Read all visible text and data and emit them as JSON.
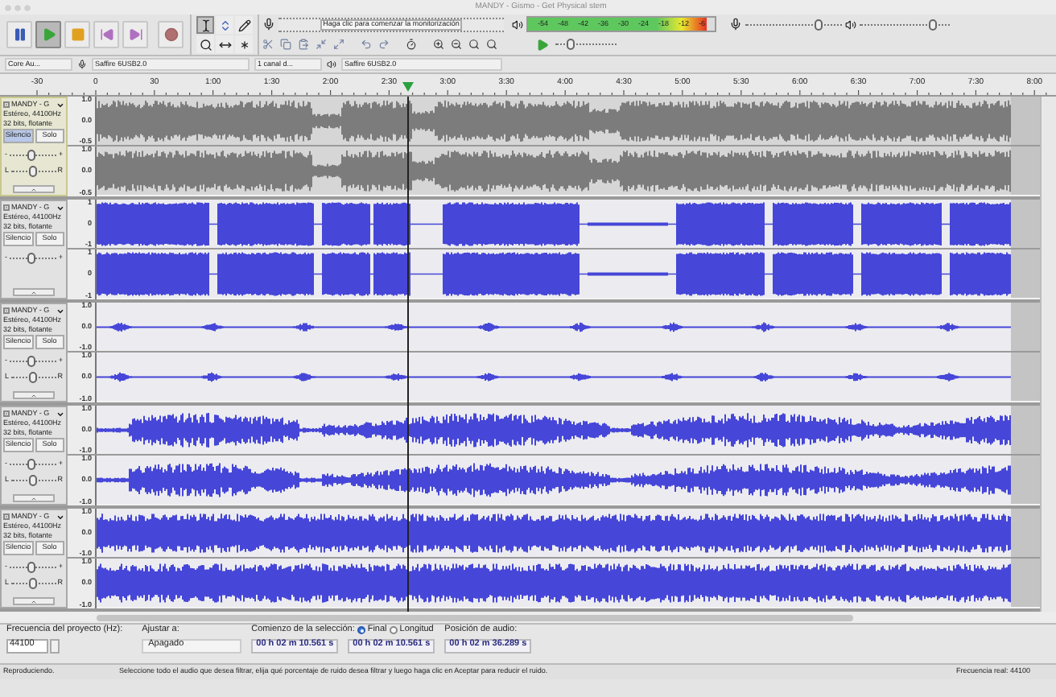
{
  "window": {
    "title": "MANDY - Gismo - Get Physical stem"
  },
  "transport": [
    {
      "kind": "pause",
      "pressed": false
    },
    {
      "kind": "play",
      "pressed": true
    },
    {
      "kind": "stop",
      "pressed": false
    },
    {
      "kind": "skip-start",
      "pressed": false
    },
    {
      "kind": "skip-end",
      "pressed": false
    },
    {
      "kind": "record",
      "pressed": false
    }
  ],
  "tools": [
    {
      "kind": "select",
      "selected": true
    },
    {
      "kind": "envelope",
      "selected": false
    },
    {
      "kind": "draw",
      "selected": false
    },
    {
      "kind": "zoom",
      "selected": false
    },
    {
      "kind": "time-shift",
      "selected": false
    },
    {
      "kind": "multi",
      "selected": false
    }
  ],
  "recording_meter": {
    "hint": "Haga clic para comenzar la monitorización"
  },
  "playback_meter": {
    "ticks": [
      "-54",
      "-48",
      "-42",
      "-36",
      "-30",
      "-24",
      "-18",
      "-12",
      "-6"
    ],
    "level": 0.96
  },
  "mixer": {
    "input_volume": {
      "level": 0.76
    },
    "output_volume": {
      "level": 0.83
    }
  },
  "play_at_speed": {
    "level": 0.25
  },
  "devices": {
    "host": "Core Au...",
    "input": "Saffire 6USB2.0",
    "channels": "1 canal d...",
    "output": "Saffire 6USB2.0"
  },
  "ruler": {
    "labels": [
      "-30",
      "0",
      "30",
      "1:00",
      "1:30",
      "2:00",
      "2:30",
      "3:00",
      "3:30",
      "4:00",
      "4:30",
      "5:00",
      "5:30",
      "6:00",
      "6:30",
      "7:00",
      "7:30",
      "8:00"
    ]
  },
  "tracks": [
    {
      "name": "MANDY - G",
      "format": "Estéreo, 44100Hz",
      "bits": "32 bits, flotante",
      "mute": "Silencio",
      "solo": "Solo",
      "muted": true,
      "selected": true,
      "gain": {
        "labels": [
          "-",
          "+"
        ],
        "level": 0.5
      },
      "pan": {
        "labels": [
          "L",
          "R"
        ],
        "level": 0.5
      },
      "channels": [
        {
          "axis": [
            "1.0",
            "0.0",
            "-0.5"
          ]
        },
        {
          "axis": [
            "1.0",
            "0.0",
            "-0.5"
          ]
        }
      ]
    },
    {
      "name": "MANDY - G",
      "format": "Estéreo, 44100Hz",
      "bits": "32 bits, flotante",
      "mute": "Silencio",
      "solo": "Solo",
      "muted": false,
      "selected": false,
      "gain": {
        "labels": [
          "-",
          "+"
        ],
        "level": 0.5
      },
      "channels": [
        {
          "axis": [
            "1",
            "0",
            "-1"
          ]
        },
        {
          "axis": [
            "1",
            "0",
            "-1"
          ]
        }
      ]
    },
    {
      "name": "MANDY - G",
      "format": "Estéreo, 44100Hz",
      "bits": "32 bits, flotante",
      "mute": "Silencio",
      "solo": "Solo",
      "muted": false,
      "selected": false,
      "gain": {
        "labels": [
          "-",
          "+"
        ],
        "level": 0.5
      },
      "pan": {
        "labels": [
          "L",
          "R"
        ],
        "level": 0.5
      },
      "channels": [
        {
          "axis": [
            "1.0",
            "0.0",
            "-1.0"
          ]
        },
        {
          "axis": [
            "1.0",
            "0.0",
            "-1.0"
          ]
        }
      ]
    },
    {
      "name": "MANDY - G",
      "format": "Estéreo, 44100Hz",
      "bits": "32 bits, flotante",
      "mute": "Silencio",
      "solo": "Solo",
      "muted": false,
      "selected": false,
      "gain": {
        "labels": [
          "-",
          "+"
        ],
        "level": 0.5
      },
      "pan": {
        "labels": [
          "L",
          "R"
        ],
        "level": 0.5
      },
      "channels": [
        {
          "axis": [
            "1.0",
            "0.0",
            "-1.0"
          ]
        },
        {
          "axis": [
            "1.0",
            "0.0",
            "-1.0"
          ]
        }
      ]
    },
    {
      "name": "MANDY - G",
      "format": "Estéreo, 44100Hz",
      "bits": "32 bits, flotante",
      "mute": "Silencio",
      "solo": "Solo",
      "muted": false,
      "selected": false,
      "gain": {
        "labels": [
          "-",
          "+"
        ],
        "level": 0.5
      },
      "pan": {
        "labels": [
          "L",
          "R"
        ],
        "level": 0.5
      },
      "channels": [
        {
          "axis": [
            "1.0",
            "0.0",
            "-1.0"
          ]
        },
        {
          "axis": [
            "1.0",
            "0.0",
            "-1.0"
          ]
        }
      ]
    }
  ],
  "selection_bar": {
    "rate_label": "Frecuencia del proyecto (Hz):",
    "rate": "44100",
    "snap_label": "Ajustar a:",
    "snap": "Apagado",
    "start_label": "Comienzo de la selección:",
    "end_options": [
      {
        "label": "Final",
        "selected": true
      },
      {
        "label": "Longitud",
        "selected": false
      }
    ],
    "start": "00 h 02 m 10.561 s",
    "end": "00 h 02 m 10.561 s",
    "position_label": "Posición de audio:",
    "position": "00 h 02 m 36.289 s"
  },
  "status_bar": {
    "state": "Reproduciendo.",
    "message": "Seleccione todo el audio que desea filtrar, elija qué porcentaje de ruido desea filtrar y luego haga clic en Aceptar para reducir el ruido.",
    "rate": "Frecuencia real: 44100"
  }
}
